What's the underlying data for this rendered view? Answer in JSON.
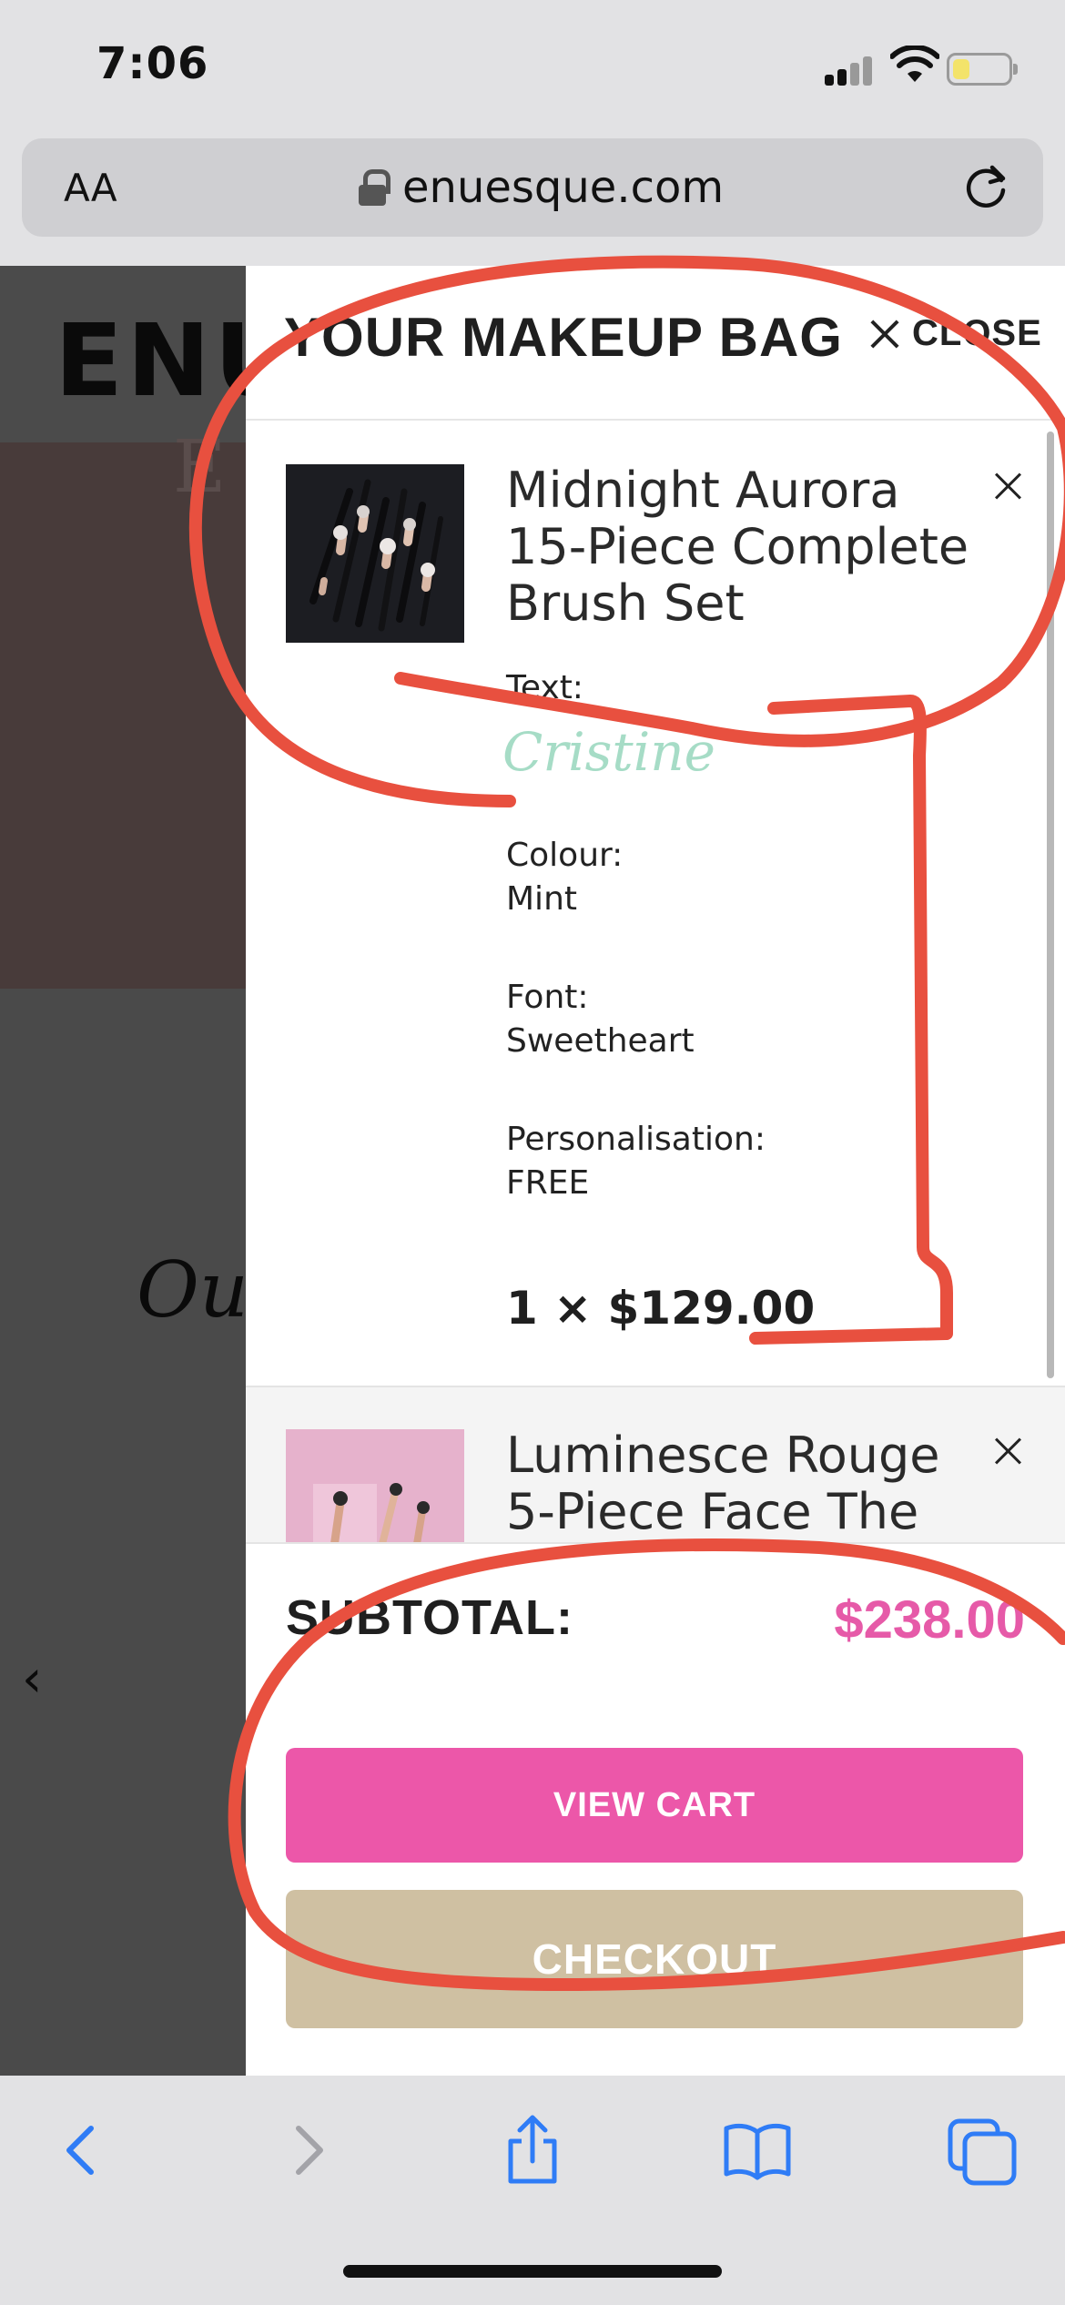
{
  "status_bar": {
    "time": "7:06"
  },
  "browser": {
    "text_size_label": "AA",
    "url": "enuesque.com"
  },
  "site": {
    "logo": "ENU",
    "heading": "Ou"
  },
  "cart": {
    "title": "YOUR MAKEUP BAG",
    "close_label": "CLOSE",
    "items": [
      {
        "name": "Midnight Aurora 15-Piece Complete Brush Set",
        "options": [
          {
            "label": "Text:",
            "value": "Cristine"
          },
          {
            "label": "Colour:",
            "value": "Mint"
          },
          {
            "label": "Font:",
            "value": "Sweetheart"
          },
          {
            "label": "Personalisation:",
            "value": "FREE"
          }
        ],
        "quantity_price": "1 × $129.00"
      },
      {
        "name": "Luminesce Rouge 5-Piece Face The"
      }
    ],
    "subtotal_label": "SUBTOTAL:",
    "subtotal_value": "$238.00",
    "view_cart_label": "VIEW CART",
    "checkout_label": "CHECKOUT"
  },
  "colors": {
    "accent_pink": "#ec57a9",
    "subtotal_pink": "#e65aa8",
    "checkout_tan": "#cfc0a2",
    "annotation_red": "#e8503f",
    "link_blue": "#2f7cf6"
  },
  "icons": [
    "lock-icon",
    "reload-icon",
    "close-x-icon",
    "remove-item-icon",
    "back-icon",
    "forward-icon",
    "share-icon",
    "bookmarks-icon",
    "tabs-icon"
  ]
}
